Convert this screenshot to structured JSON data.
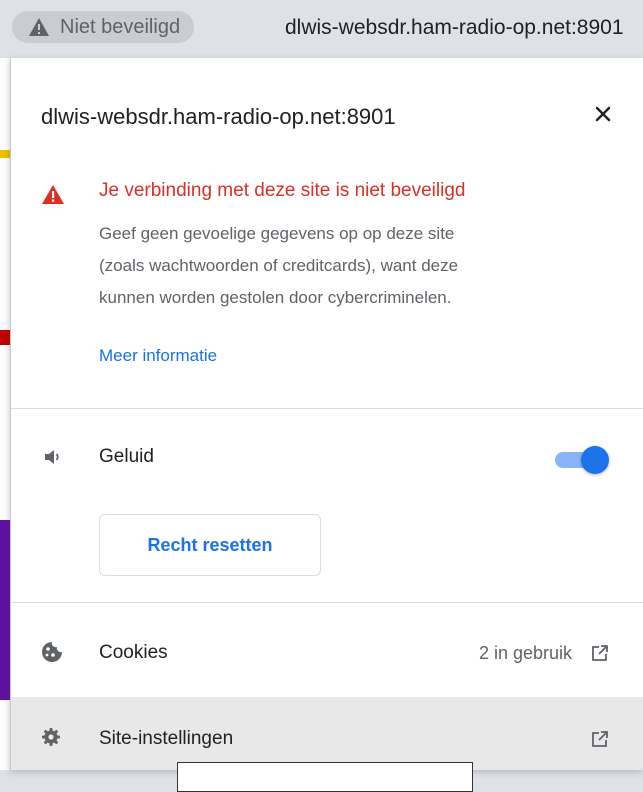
{
  "omnibox": {
    "security_chip_label": "Niet beveiligd",
    "url": "dlwis-websdr.ham-radio-op.net:8901"
  },
  "popup": {
    "title": "dlwis-websdr.ham-radio-op.net:8901",
    "close_icon": "close-icon",
    "warning": {
      "title": "Je verbinding met deze site is niet beveiligd",
      "body_lines": [
        "Geef geen gevoelige gegevens op op deze site",
        "(zoals wachtwoorden of creditcards), want deze",
        "kunnen worden gestolen door cybercriminelen."
      ],
      "more_info": "Meer informatie",
      "color": "#d93025"
    },
    "permissions": [
      {
        "icon": "speaker-icon",
        "label": "Geluid",
        "enabled": true
      }
    ],
    "reset_button": "Recht resetten",
    "rows": [
      {
        "icon": "cookie-icon",
        "label": "Cookies",
        "status": "2 in gebruik",
        "external_icon": "external-link-icon"
      },
      {
        "icon": "gear-icon",
        "label": "Site-instellingen",
        "status": "",
        "external_icon": "external-link-icon"
      }
    ]
  },
  "colors": {
    "accent": "#1a73e8",
    "toggle_track": "#8ab4f8",
    "error": "#d93025",
    "hover_row": "#e8e8e8"
  }
}
